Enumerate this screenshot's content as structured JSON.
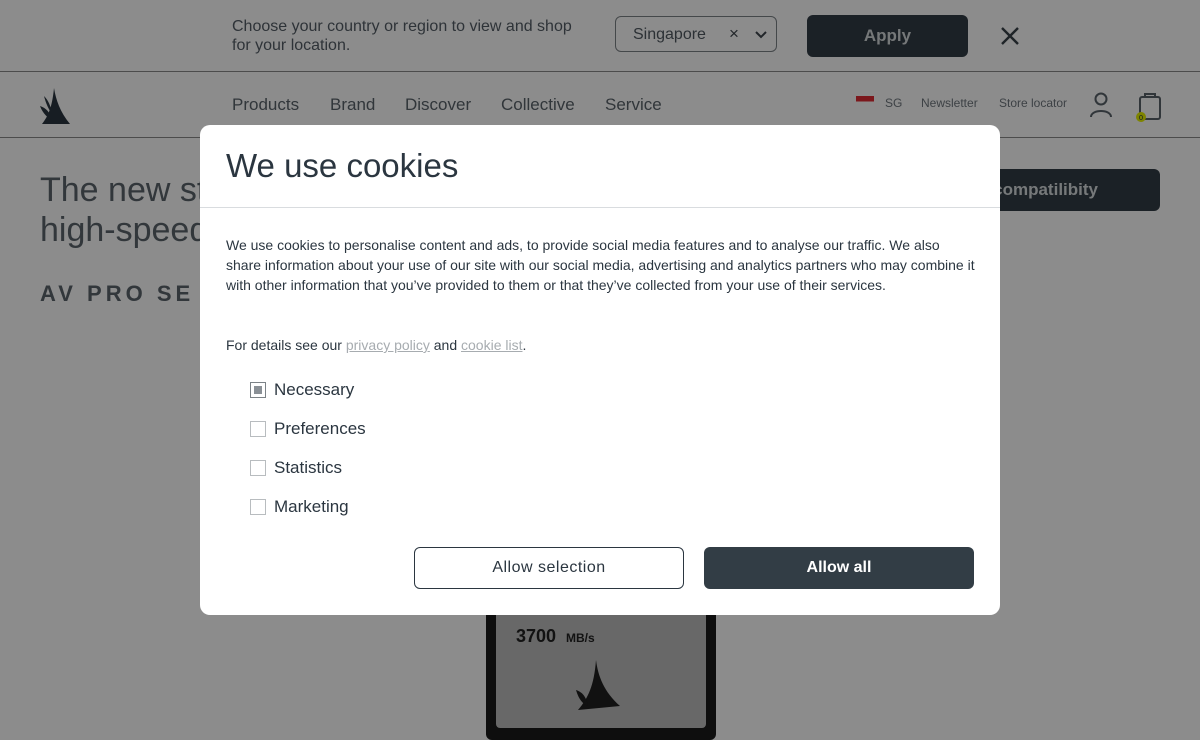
{
  "region_banner": {
    "message": "Choose your country or region to view and shop for your location.",
    "selected_region": "Singapore",
    "clear_glyph": "×",
    "apply_label": "Apply"
  },
  "header": {
    "nav": [
      "Products",
      "Brand",
      "Discover",
      "Collective",
      "Service"
    ],
    "country_code": "SG",
    "newsletter": "Newsletter",
    "store_locator": "Store locator",
    "cart_count": "0"
  },
  "hero": {
    "title_line1": "The new st",
    "title_line2": "high-speed",
    "subtitle": "AV PRO SE",
    "compat_button": "compatilibity",
    "product_speed": "3700",
    "product_unit": "MB/s"
  },
  "cookie_modal": {
    "title": "We use cookies",
    "body": "We use cookies to personalise content and ads, to provide social media features and to analyse our traffic. We also share information about your use of our site with our social media, advertising and analytics partners who may combine it with other information that you’ve provided to them or that they’ve collected from your use of their services.",
    "details_prefix": "For details see our",
    "privacy_link": "privacy policy",
    "and_text": "and",
    "cookie_link": "cookie list",
    "period": ".",
    "options": [
      {
        "label": "Necessary",
        "checked": true
      },
      {
        "label": "Preferences",
        "checked": false
      },
      {
        "label": "Statistics",
        "checked": false
      },
      {
        "label": "Marketing",
        "checked": false
      }
    ],
    "allow_selection": "Allow selection",
    "allow_all": "Allow all"
  },
  "colors": {
    "dark_button": "#323d45",
    "text": "#2b3640",
    "link": "#a7acb0",
    "flag_red": "#e02b34",
    "cart_badge": "#e6f000"
  }
}
